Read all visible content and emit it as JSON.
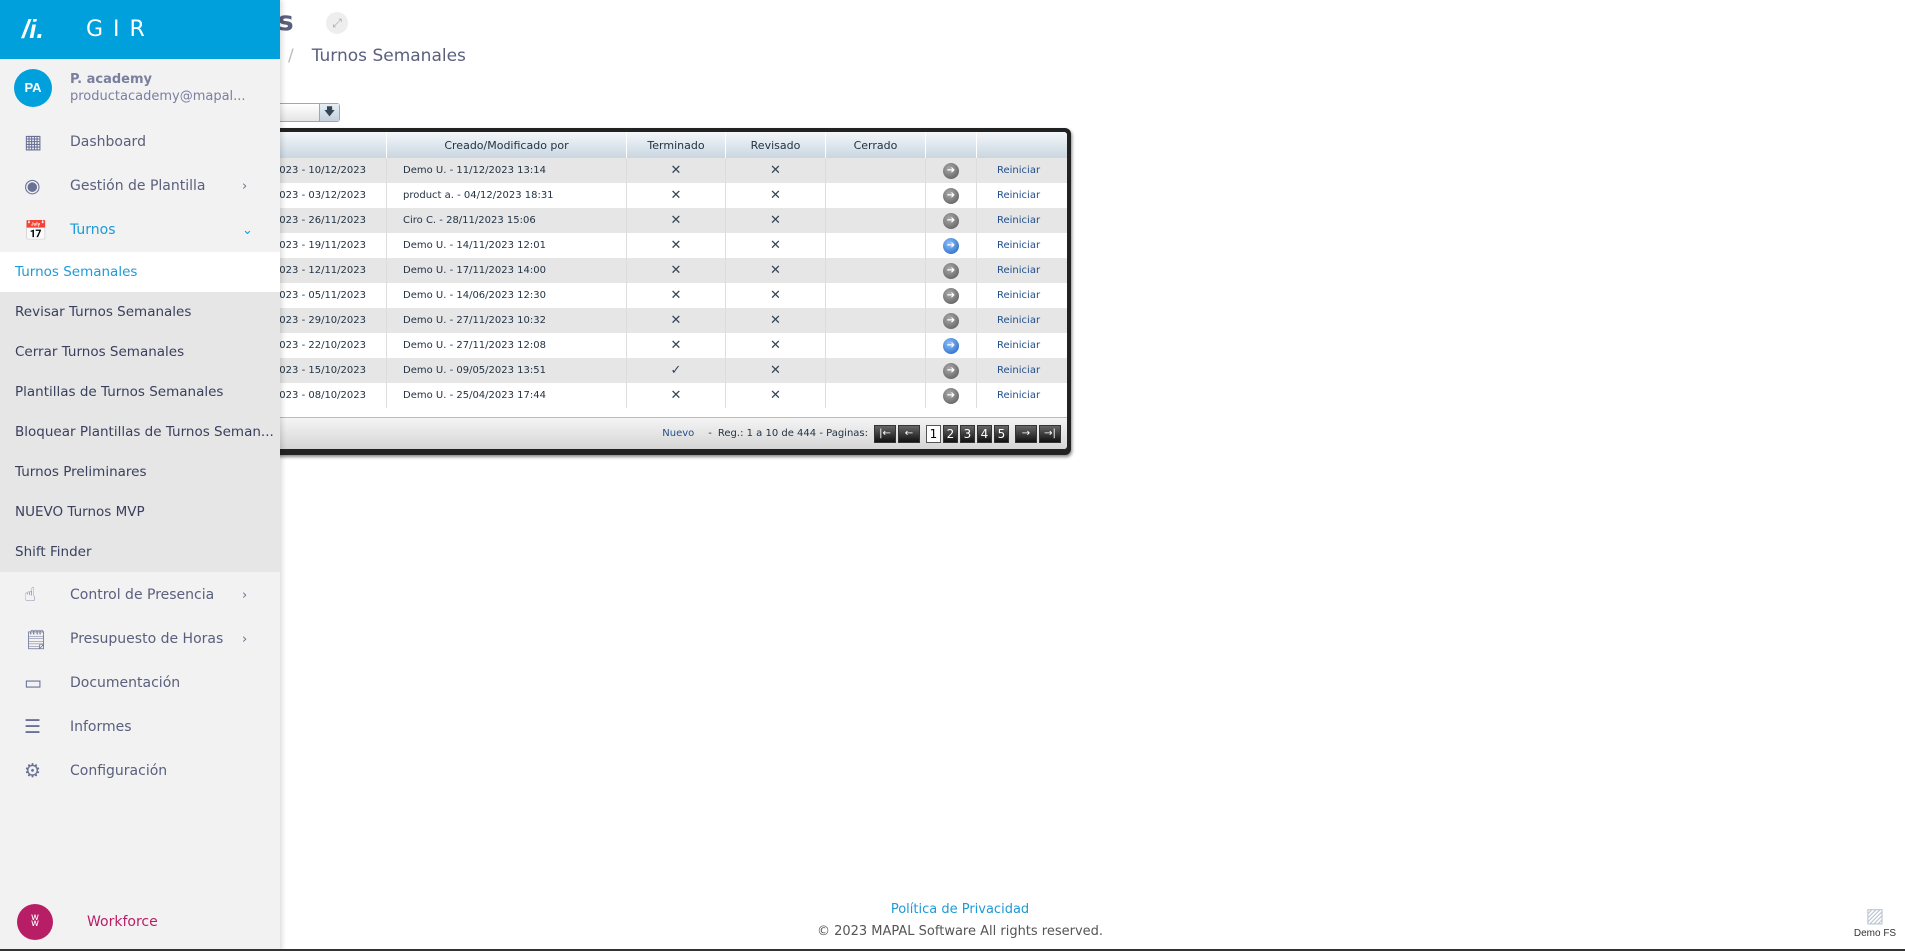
{
  "header": {
    "title_fragment": "les",
    "breadcrumb_current": "Turnos Semanales",
    "breadcrumb_sep": "/"
  },
  "app": {
    "name": "GIR",
    "logo": "GIR logo"
  },
  "user": {
    "initials": "PA",
    "name": "P. academy",
    "email": "productacademy@mapal..."
  },
  "menu": [
    {
      "label": "Dashboard",
      "icon": "dashboard-icon"
    },
    {
      "label": "Gestión de Plantilla",
      "icon": "user-circle-icon"
    },
    {
      "label": "Turnos",
      "icon": "calendar-clock-icon"
    }
  ],
  "submenu": [
    "Turnos Semanales",
    "Revisar Turnos Semanales",
    "Cerrar Turnos Semanales",
    "Plantillas de Turnos Semanales",
    "Bloquear Plantillas de Turnos Seman...",
    "Turnos Preliminares",
    "NUEVO Turnos MVP",
    "Shift Finder"
  ],
  "menu2": [
    {
      "label": "Control de Presencia",
      "icon": "hand-pointer-icon"
    },
    {
      "label": "Presupuesto de Horas",
      "icon": "budget-clock-icon"
    },
    {
      "label": "Documentación",
      "icon": "archive-icon"
    },
    {
      "label": "Informes",
      "icon": "report-icon"
    },
    {
      "label": "Configuración",
      "icon": "gear-icon"
    }
  ],
  "workforce": {
    "label": "Workforce"
  },
  "table": {
    "headers": [
      "",
      "Creado/Modificado por",
      "Terminado",
      "Revisado",
      "Cerrado",
      "",
      ""
    ],
    "rows": [
      {
        "period": "023 - 10/12/2023",
        "by": "Demo U. - 11/12/2023 13:14",
        "terminado": "✕",
        "revisado": "✕",
        "cerrado": "",
        "arrow": "gray",
        "action": "Reiniciar"
      },
      {
        "period": "023 - 03/12/2023",
        "by": "product a. - 04/12/2023 18:31",
        "terminado": "✕",
        "revisado": "✕",
        "cerrado": "",
        "arrow": "gray",
        "action": "Reiniciar"
      },
      {
        "period": "023 - 26/11/2023",
        "by": "Ciro C. - 28/11/2023 15:06",
        "terminado": "✕",
        "revisado": "✕",
        "cerrado": "",
        "arrow": "gray",
        "action": "Reiniciar"
      },
      {
        "period": "023 - 19/11/2023",
        "by": "Demo U. - 14/11/2023 12:01",
        "terminado": "✕",
        "revisado": "✕",
        "cerrado": "",
        "arrow": "blue",
        "action": "Reiniciar"
      },
      {
        "period": "023 - 12/11/2023",
        "by": "Demo U. - 17/11/2023 14:00",
        "terminado": "✕",
        "revisado": "✕",
        "cerrado": "",
        "arrow": "gray",
        "action": "Reiniciar"
      },
      {
        "period": "023 - 05/11/2023",
        "by": "Demo U. - 14/06/2023 12:30",
        "terminado": "✕",
        "revisado": "✕",
        "cerrado": "",
        "arrow": "gray",
        "action": "Reiniciar"
      },
      {
        "period": "023 - 29/10/2023",
        "by": "Demo U. - 27/11/2023 10:32",
        "terminado": "✕",
        "revisado": "✕",
        "cerrado": "",
        "arrow": "gray",
        "action": "Reiniciar"
      },
      {
        "period": "023 - 22/10/2023",
        "by": "Demo U. - 27/11/2023 12:08",
        "terminado": "✕",
        "revisado": "✕",
        "cerrado": "",
        "arrow": "blue",
        "action": "Reiniciar"
      },
      {
        "period": "023 - 15/10/2023",
        "by": "Demo U. - 09/05/2023 13:51",
        "terminado": "✓",
        "revisado": "✕",
        "cerrado": "",
        "arrow": "gray",
        "action": "Reiniciar"
      },
      {
        "period": "023 - 08/10/2023",
        "by": "Demo U. - 25/04/2023 17:44",
        "terminado": "✕",
        "revisado": "✕",
        "cerrado": "",
        "arrow": "gray",
        "action": "Reiniciar"
      }
    ]
  },
  "pager": {
    "new_label": "Nuevo",
    "dash": "-",
    "records": "Reg.: 1 a 10 de 444 - Paginas:",
    "pages": [
      "1",
      "2",
      "3",
      "4",
      "5"
    ],
    "current_page": "1"
  },
  "footer": {
    "privacy": "Política de Privacidad",
    "copyright": "© 2023 MAPAL Software All rights reserved."
  },
  "env": {
    "label": "Demo FS"
  },
  "colors": {
    "brand": "#00a0dc",
    "active": "#1e9ad6",
    "workforce": "#b81e66"
  }
}
